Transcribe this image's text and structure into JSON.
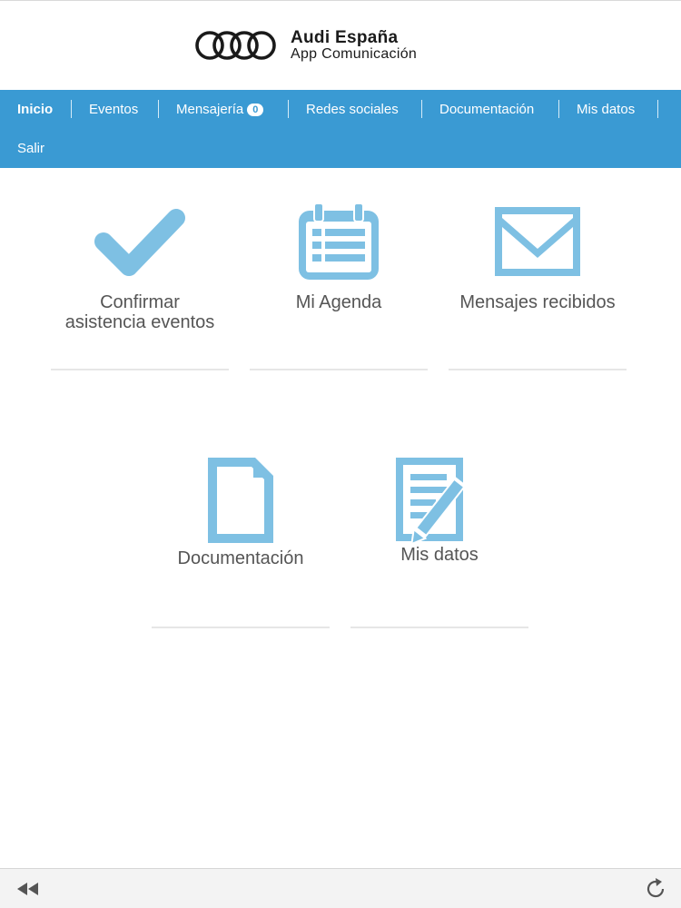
{
  "brand": {
    "title": "Audi España",
    "subtitle": "App Comunicación"
  },
  "nav": {
    "items": [
      {
        "label": "Inicio",
        "active": true
      },
      {
        "label": "Eventos"
      },
      {
        "label": "Mensajería",
        "badge": "0"
      },
      {
        "label": "Redes sociales"
      },
      {
        "label": "Documentación"
      },
      {
        "label": "Mis datos"
      },
      {
        "label": "Salir"
      }
    ]
  },
  "tiles": [
    {
      "icon": "checkmark-icon",
      "line1": "Confirmar",
      "line2": "asistencia eventos"
    },
    {
      "icon": "calendar-icon",
      "line1": "Mi Agenda",
      "line2": ""
    },
    {
      "icon": "envelope-icon",
      "line1": "Mensajes recibidos",
      "line2": ""
    },
    {
      "icon": "document-icon",
      "line1": "Documentación",
      "line2": ""
    },
    {
      "icon": "edit-document-icon",
      "line1": "Mis datos",
      "line2": ""
    }
  ],
  "colors": {
    "nav_bg": "#3a9ad3",
    "icon": "#7ec0e3",
    "label": "#555555"
  },
  "bottom_bar": {
    "back_icon": "rewind-icon",
    "reload_icon": "reload-icon"
  }
}
